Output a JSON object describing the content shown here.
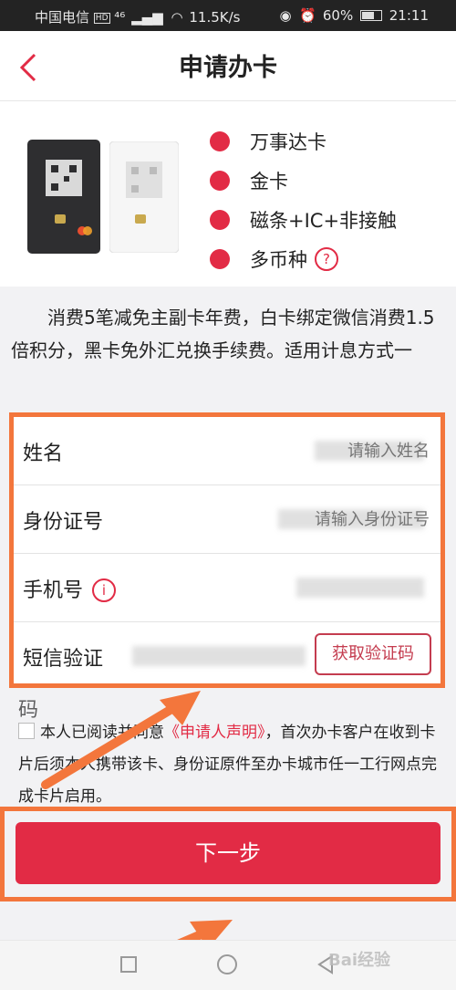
{
  "status_bar": {
    "carrier": "中国电信",
    "hd": "HD",
    "signal": "⁴⁶",
    "speed": "11.5K/s",
    "battery": "60%",
    "time": "21:11"
  },
  "header": {
    "title": "申请办卡"
  },
  "card": {
    "features": [
      "万事达卡",
      "金卡",
      "磁条+IC+非接触",
      "多币种"
    ],
    "help_mark": "?"
  },
  "description": "消费5笔减免主副卡年费，白卡绑定微信消费1.5倍积分，黑卡免外汇兑换手续费。适用计息方式一",
  "form": {
    "name_label": "姓名",
    "name_placeholder": "请输入姓名",
    "id_label": "身份证号",
    "id_placeholder": "请输入身份证号",
    "phone_label": "手机号",
    "info_mark": "i",
    "sms_label": "短信验证",
    "sms_placeholder": "请输入短信验证码",
    "sms_button": "获取验证码",
    "sms_label_wrap": "码"
  },
  "agreement": {
    "prefix": "本人已阅读并同意",
    "link": "《申请人声明》",
    "suffix": "，首次办卡客户在收到卡片后须本人携带该卡、身份证原件至办卡城市任一工行网点完成卡片启用。"
  },
  "next_button": "下一步",
  "watermark": "Bai经验",
  "colors": {
    "accent": "#e22b45",
    "highlight": "#f3763c"
  }
}
